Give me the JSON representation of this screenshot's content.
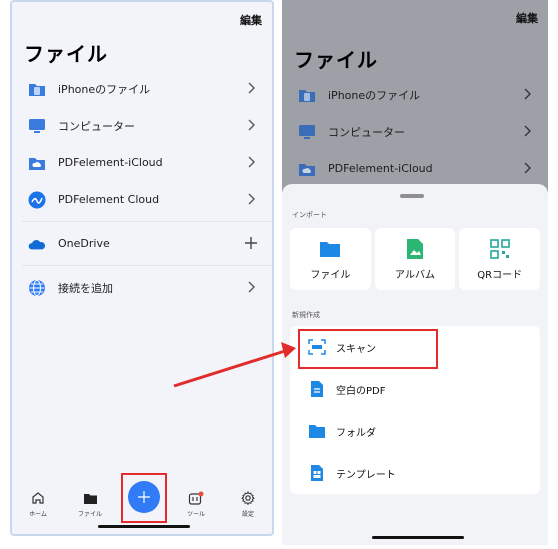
{
  "left": {
    "edit_label": "編集",
    "title": "ファイル",
    "locations": [
      {
        "label": "iPhoneのファイル",
        "icon": "iphone-folder-icon"
      },
      {
        "label": "コンピューター",
        "icon": "computer-icon"
      },
      {
        "label": "PDFelement-iCloud",
        "icon": "cloud-folder-icon"
      },
      {
        "label": "PDFelement Cloud",
        "icon": "pdfelement-cloud-icon"
      },
      {
        "label": "OneDrive",
        "icon": "onedrive-icon"
      },
      {
        "label": "接続を追加",
        "icon": "globe-icon"
      }
    ],
    "tabs": [
      {
        "label": "ホーム",
        "icon": "home-icon"
      },
      {
        "label": "ファイル",
        "icon": "folder-icon"
      },
      {
        "label": "ツール",
        "icon": "tools-icon"
      },
      {
        "label": "設定",
        "icon": "gear-icon"
      }
    ]
  },
  "right": {
    "edit_label": "編集",
    "title": "ファイル",
    "locations": [
      {
        "label": "iPhoneのファイル"
      },
      {
        "label": "コンピューター"
      },
      {
        "label": "PDFelement-iCloud"
      }
    ],
    "import_section": "インポート",
    "import_items": [
      {
        "label": "ファイル",
        "icon": "folder-icon"
      },
      {
        "label": "アルバム",
        "icon": "album-icon"
      },
      {
        "label": "QRコード",
        "icon": "qr-code-icon"
      }
    ],
    "create_section": "新規作成",
    "create_items": [
      {
        "label": "スキャン",
        "icon": "scan-icon"
      },
      {
        "label": "空白のPDF",
        "icon": "blank-pdf-icon"
      },
      {
        "label": "フォルダ",
        "icon": "folder-icon"
      },
      {
        "label": "テンプレート",
        "icon": "template-icon"
      }
    ]
  },
  "colors": {
    "accent": "#2f7cf6",
    "highlight": "#e22b2b",
    "dim_overlay": "#9da0a6"
  }
}
